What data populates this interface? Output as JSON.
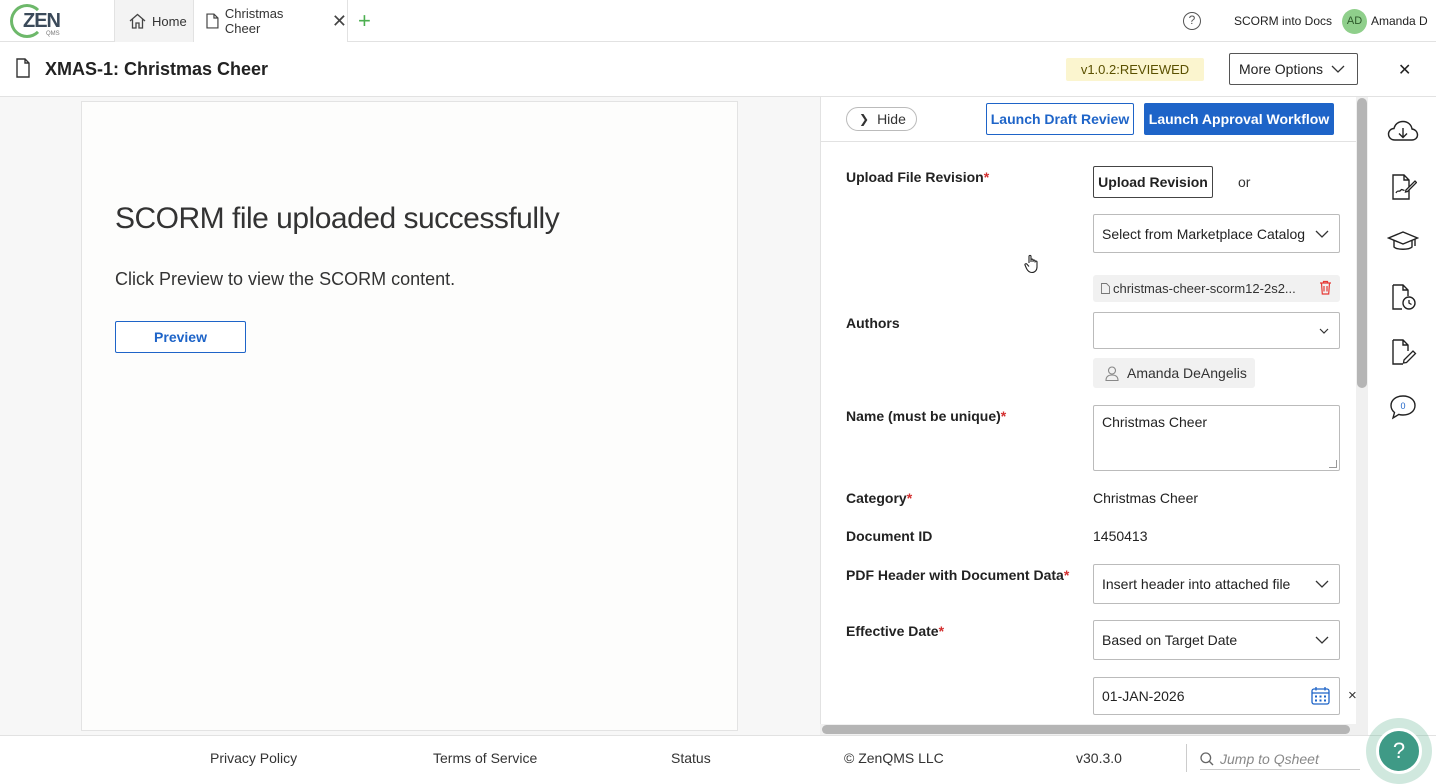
{
  "topbar": {
    "logo_text": "ZEN",
    "logo_sub": "QMS",
    "tabs": [
      {
        "label": "Home",
        "icon": "home-icon"
      },
      {
        "label": "Christmas Cheer",
        "icon": "document-icon"
      }
    ],
    "add_tab_label": "+",
    "org_name": "SCORM into Docs",
    "user_initials": "AD",
    "user_name": "Amanda D"
  },
  "docbar": {
    "title": "XMAS-1: Christmas Cheer",
    "version_badge": "v1.0.2:REVIEWED",
    "more_options_label": "More Options"
  },
  "preview": {
    "heading": "SCORM file uploaded successfully",
    "subtext": "Click Preview to view the SCORM content.",
    "preview_button": "Preview"
  },
  "panel": {
    "hide_label": "Hide",
    "launch_draft_review": "Launch Draft Review",
    "launch_approval_workflow": "Launch Approval Workflow",
    "fields": {
      "upload_file_revision": {
        "label": "Upload File Revision",
        "required": "*"
      },
      "upload_revision_button": "Upload Revision",
      "or_text": "or",
      "marketplace_select": "Select from Marketplace Catalog",
      "file_name": "christmas-cheer-scorm12-2s2...",
      "authors": {
        "label": "Authors",
        "required": ""
      },
      "author_chip": "Amanda DeAngelis",
      "name": {
        "label": "Name (must be unique)",
        "required": "*",
        "value": "Christmas Cheer"
      },
      "category": {
        "label": "Category",
        "required": "*",
        "value": "Christmas Cheer"
      },
      "document_id": {
        "label": "Document ID",
        "value": "1450413"
      },
      "pdf_header": {
        "label": "PDF Header with Document Data",
        "required": "*",
        "value": "Insert header into attached file"
      },
      "effective_date": {
        "label": "Effective Date",
        "required": "*",
        "value": "Based on Target Date"
      },
      "date_value": "01-JAN-2026",
      "date_clear": "×"
    }
  },
  "side_rail": {
    "icons": [
      "cloud-download-icon",
      "signature-icon",
      "training-cap-icon",
      "document-history-icon",
      "document-edit-icon",
      "comments-icon"
    ],
    "comments_count": "0"
  },
  "footer": {
    "privacy": "Privacy Policy",
    "terms": "Terms of Service",
    "status": "Status",
    "copyright": "© ZenQMS LLC",
    "version": "v30.3.0",
    "jump_placeholder": "Jump to Qsheet",
    "help": "?"
  },
  "colors": {
    "primary": "#1e64c8",
    "accent_green": "#6db86a",
    "badge_bg": "#fbf5cf",
    "required": "#d32f2f"
  }
}
